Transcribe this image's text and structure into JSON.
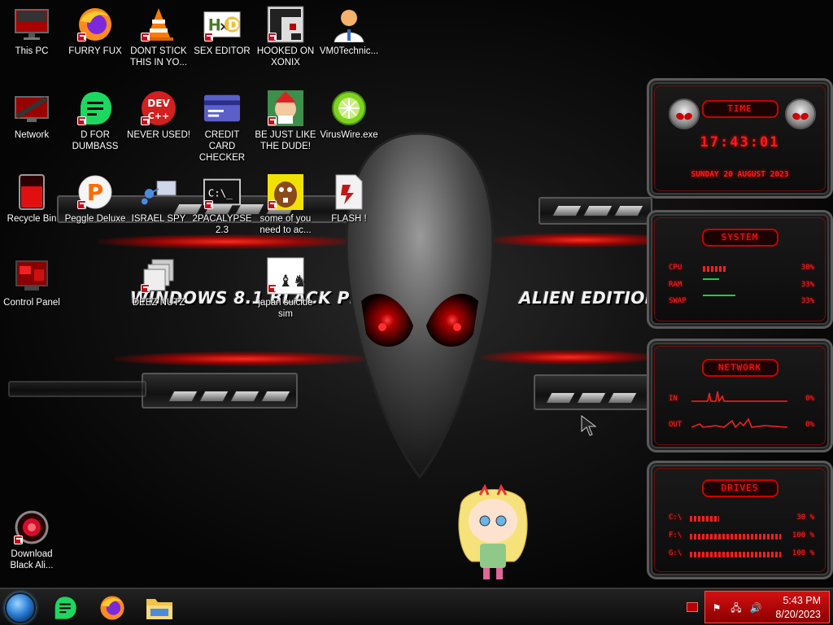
{
  "wallpaper": {
    "title_left": "WINDOWS 8.1 BLACK PRO",
    "title_right": "ALIEN EDITION 20"
  },
  "desktop_icons": [
    {
      "label": "This PC"
    },
    {
      "label": "FURRY FUX"
    },
    {
      "label": "DONT STICK THIS IN YO..."
    },
    {
      "label": "SEX EDITOR"
    },
    {
      "label": "HOOKED ON XONIX"
    },
    {
      "label": "VM0Technic..."
    },
    {
      "label": "Network"
    },
    {
      "label": "D FOR DUMBASS"
    },
    {
      "label": "NEVER USED!"
    },
    {
      "label": "CREDIT CARD CHECKER"
    },
    {
      "label": "BE JUST LIKE THE DUDE!"
    },
    {
      "label": "VirusWire.exe"
    },
    {
      "label": "Recycle Bin"
    },
    {
      "label": "Peggle Deluxe"
    },
    {
      "label": "ISRAEL SPY"
    },
    {
      "label": "2PACALYPSE 2.3"
    },
    {
      "label": "some of you need to ac..."
    },
    {
      "label": "FLASH !"
    },
    {
      "label": "Control Panel"
    },
    {
      "label": "DEEZ NUTZ"
    },
    {
      "label": "japan suicide sim"
    },
    {
      "label": "Download Black Ali..."
    }
  ],
  "gadgets": {
    "time": {
      "title": "TIME",
      "clock": "17:43:01",
      "date": "SUNDAY 20 AUGUST 2023"
    },
    "system": {
      "title": "SYSTEM",
      "rows": [
        {
          "label": "CPU",
          "value": "30%",
          "level": 0.3
        },
        {
          "label": "RAM",
          "value": "33%",
          "level": 0.33
        },
        {
          "label": "SWAP",
          "value": "33%",
          "level": 0.33
        }
      ]
    },
    "network": {
      "title": "NETWORK",
      "rows": [
        {
          "label": "IN",
          "value": "0%"
        },
        {
          "label": "OUT",
          "value": "0%"
        }
      ]
    },
    "drives": {
      "title": "DRIVES",
      "rows": [
        {
          "label": "C:\\",
          "value": "30 %",
          "level": 0.3
        },
        {
          "label": "F:\\",
          "value": "100 %",
          "level": 1.0
        },
        {
          "label": "G:\\",
          "value": "100 %",
          "level": 1.0
        }
      ]
    }
  },
  "taskbar": {
    "pinned": [
      "start-orb",
      "greenish-app",
      "firefox",
      "file-explorer"
    ],
    "clock_time": "5:43 PM",
    "clock_date": "8/20/2023"
  },
  "colors": {
    "accent_red": "#ff1a1a",
    "tray_red": "#c80e0e",
    "meter_green": "#1fcf3a"
  }
}
